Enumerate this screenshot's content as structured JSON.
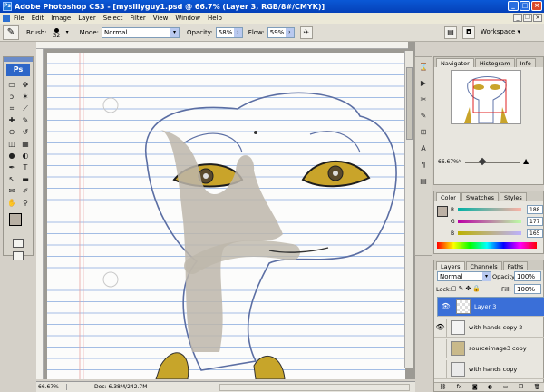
{
  "window": {
    "title": "Adobe Photoshop CS3 - [mysillyguy1.psd @ 66.7% (Layer 3, RGB/8#/CMYK)]",
    "app_icon": "Ps"
  },
  "menu": [
    "File",
    "Edit",
    "Image",
    "Layer",
    "Select",
    "Filter",
    "View",
    "Window",
    "Help"
  ],
  "options": {
    "brush_label": "Brush:",
    "brush_size": "32",
    "mode_label": "Mode:",
    "mode_value": "Normal",
    "opacity_label": "Opacity:",
    "opacity_value": "58%",
    "flow_label": "Flow:",
    "flow_value": "59%",
    "workspace_label": "Workspace ▾"
  },
  "tools": {
    "logo": "Ps",
    "icons": [
      "marquee-icon",
      "move-icon",
      "lasso-icon",
      "wand-icon",
      "crop-icon",
      "slice-icon",
      "healing-icon",
      "brush-icon",
      "stamp-icon",
      "history-brush-icon",
      "eraser-icon",
      "gradient-icon",
      "blur-icon",
      "dodge-icon",
      "pen-icon",
      "type-icon",
      "path-select-icon",
      "shape-icon",
      "notes-icon",
      "eyedropper-icon",
      "hand-icon",
      "zoom-icon"
    ],
    "glyphs": [
      "▭",
      "✥",
      "ↄ",
      "✶",
      "⌗",
      "⟋",
      "✚",
      "✎",
      "⊙",
      "↺",
      "◫",
      "▦",
      "●",
      "◐",
      "✒",
      "T",
      "↖",
      "▬",
      "✉",
      "✐",
      "✋",
      "⚲"
    ],
    "fg_color": "#b8b0a4",
    "bg_color": "#ffffff"
  },
  "status": {
    "zoom": "66.67%",
    "doc": "Doc: 6.38M/242.7M"
  },
  "navigator": {
    "tabs": [
      "Navigator",
      "Histogram",
      "Info"
    ],
    "zoom": "66.67%"
  },
  "color": {
    "tabs": [
      "Color",
      "Swatches",
      "Styles"
    ],
    "channels": [
      {
        "name": "R",
        "value": "188"
      },
      {
        "name": "G",
        "value": "177"
      },
      {
        "name": "B",
        "value": "165"
      }
    ]
  },
  "layers": {
    "tabs": [
      "Layers",
      "Channels",
      "Paths"
    ],
    "blend_mode": "Normal",
    "opacity_label": "Opacity:",
    "opacity_value": "100%",
    "lock_label": "Lock:",
    "fill_label": "Fill:",
    "fill_value": "100%",
    "items": [
      {
        "name": "Layer 3",
        "selected": true,
        "visible": true
      },
      {
        "name": "with hands copy 2",
        "selected": false,
        "visible": true
      },
      {
        "name": "sourceimage3 copy",
        "selected": false,
        "visible": false
      },
      {
        "name": "with hands copy",
        "selected": false,
        "visible": false
      }
    ]
  }
}
